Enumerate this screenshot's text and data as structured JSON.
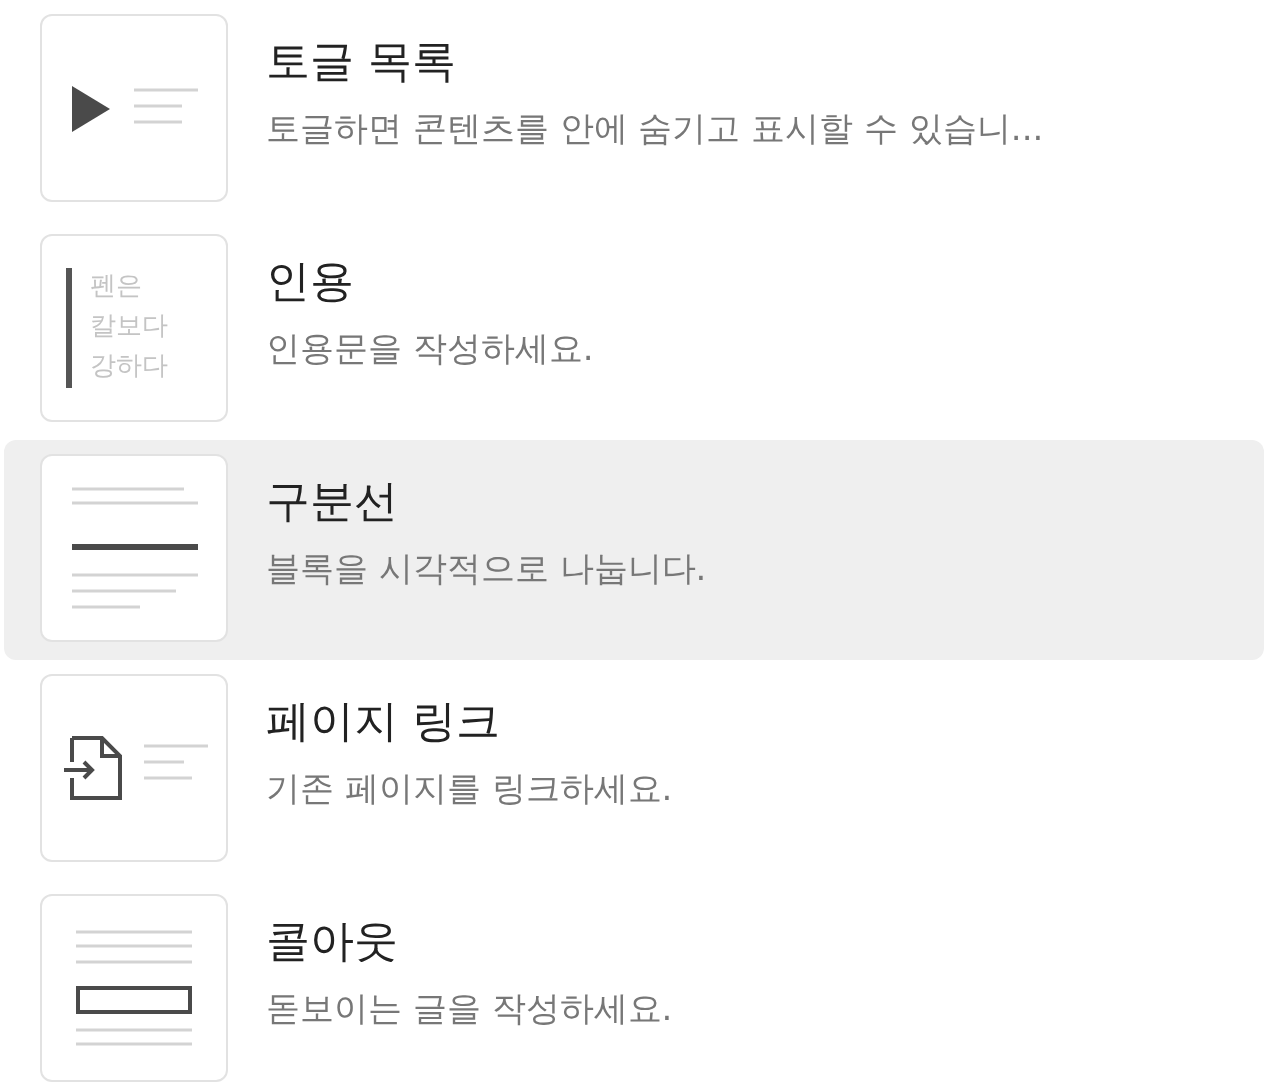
{
  "items": [
    {
      "kind": "toggle",
      "title": "토글 목록",
      "description": "토글하면 콘텐츠를 안에 숨기고 표시할 수 있습니...",
      "selected": false
    },
    {
      "kind": "quote",
      "title": "인용",
      "description": "인용문을 작성하세요.",
      "preview": [
        "펜은",
        "칼보다",
        "강하다"
      ],
      "selected": false
    },
    {
      "kind": "divider",
      "title": "구분선",
      "description": "블록을 시각적으로 나눕니다.",
      "selected": true
    },
    {
      "kind": "page-link",
      "title": "페이지 링크",
      "description": "기존 페이지를 링크하세요.",
      "selected": false
    },
    {
      "kind": "callout",
      "title": "콜아웃",
      "description": "돋보이는 글을 작성하세요.",
      "selected": false
    }
  ]
}
